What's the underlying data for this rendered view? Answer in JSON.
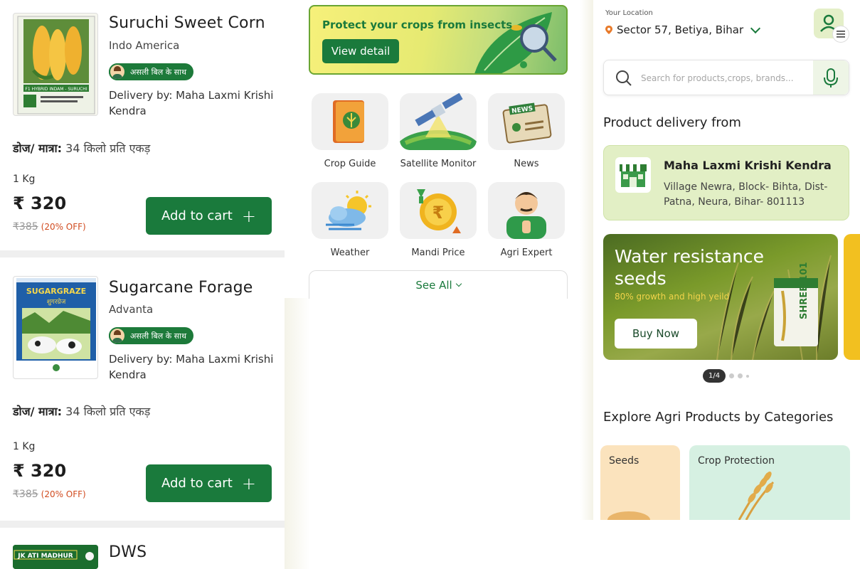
{
  "products": [
    {
      "name": "Suruchi Sweet Corn",
      "brand": "Indo America",
      "badge": "असली बिल के साथ",
      "delivery": "Delivery by: Maha Laxmi Krishi Kendra",
      "dose_label": "डोज/ मात्रा:",
      "dose_value": "34 किलो प्रति एकड़",
      "quantity": "1 Kg",
      "price": "₹ 320",
      "mrp": "₹385",
      "discount": "(20% OFF)",
      "add_label": "Add to cart",
      "add_icon": "+",
      "pack_text": "F1 HYBRID INDAM - SURUCHI"
    },
    {
      "name": "Sugarcane Forage",
      "brand": "Advanta",
      "badge": "असली बिल के साथ",
      "delivery": "Delivery by: Maha Laxmi Krishi Kendra",
      "dose_label": "डोज/ मात्रा:",
      "dose_value": "34 किलो प्रति एकड़",
      "quantity": "1 Kg",
      "price": "₹ 320",
      "mrp": "₹385",
      "discount": "(20% OFF)",
      "add_label": "Add to cart",
      "add_icon": "+",
      "pack_text": "SUGARGRAZE",
      "pack_text2": "शुगरग्रेज"
    },
    {
      "name": "DWS",
      "pack_text": "JK ATI MADHUR"
    }
  ],
  "banner": {
    "text": "Protect your crops from insects",
    "button": "View detail"
  },
  "services": [
    {
      "label": "Crop Guide",
      "icon": "crop-guide-icon"
    },
    {
      "label": "Satellite Monitor",
      "icon": "satellite-icon"
    },
    {
      "label": "News",
      "icon": "news-icon",
      "icon_text": "NEWS"
    },
    {
      "label": "Weather",
      "icon": "weather-icon"
    },
    {
      "label": "Mandi Price",
      "icon": "rupee-coin-icon",
      "icon_text": "₹"
    },
    {
      "label": "Agri Expert",
      "icon": "agri-expert-icon"
    }
  ],
  "see_all": "See All",
  "location": {
    "label": "Your Location",
    "value": "Sector 57, Betiya, Bihar"
  },
  "search": {
    "placeholder": "Search for products,crops, brands..."
  },
  "delivery_section": {
    "title": "Product delivery from",
    "shop_name": "Maha Laxmi Krishi Kendra",
    "shop_address": "Village Newra, Block- Bihta, Dist- Patna, Neura, Bihar- 801113"
  },
  "promo": {
    "title": "Water resistance seeds",
    "subtitle": "80% growth and high yeild",
    "button": "Buy Now",
    "pack_text": "SHREE-101",
    "pager": "1/4"
  },
  "categories_section": {
    "title": "Explore Agri Products by Categories",
    "items": [
      {
        "label": "Seeds",
        "color": "#fbe3bd"
      },
      {
        "label": "Crop Protection",
        "color": "#d6f0e2"
      }
    ]
  },
  "colors": {
    "primary": "#1a7a3c",
    "discount": "#d14b1f",
    "promo_yellow": "#f1d34a"
  }
}
